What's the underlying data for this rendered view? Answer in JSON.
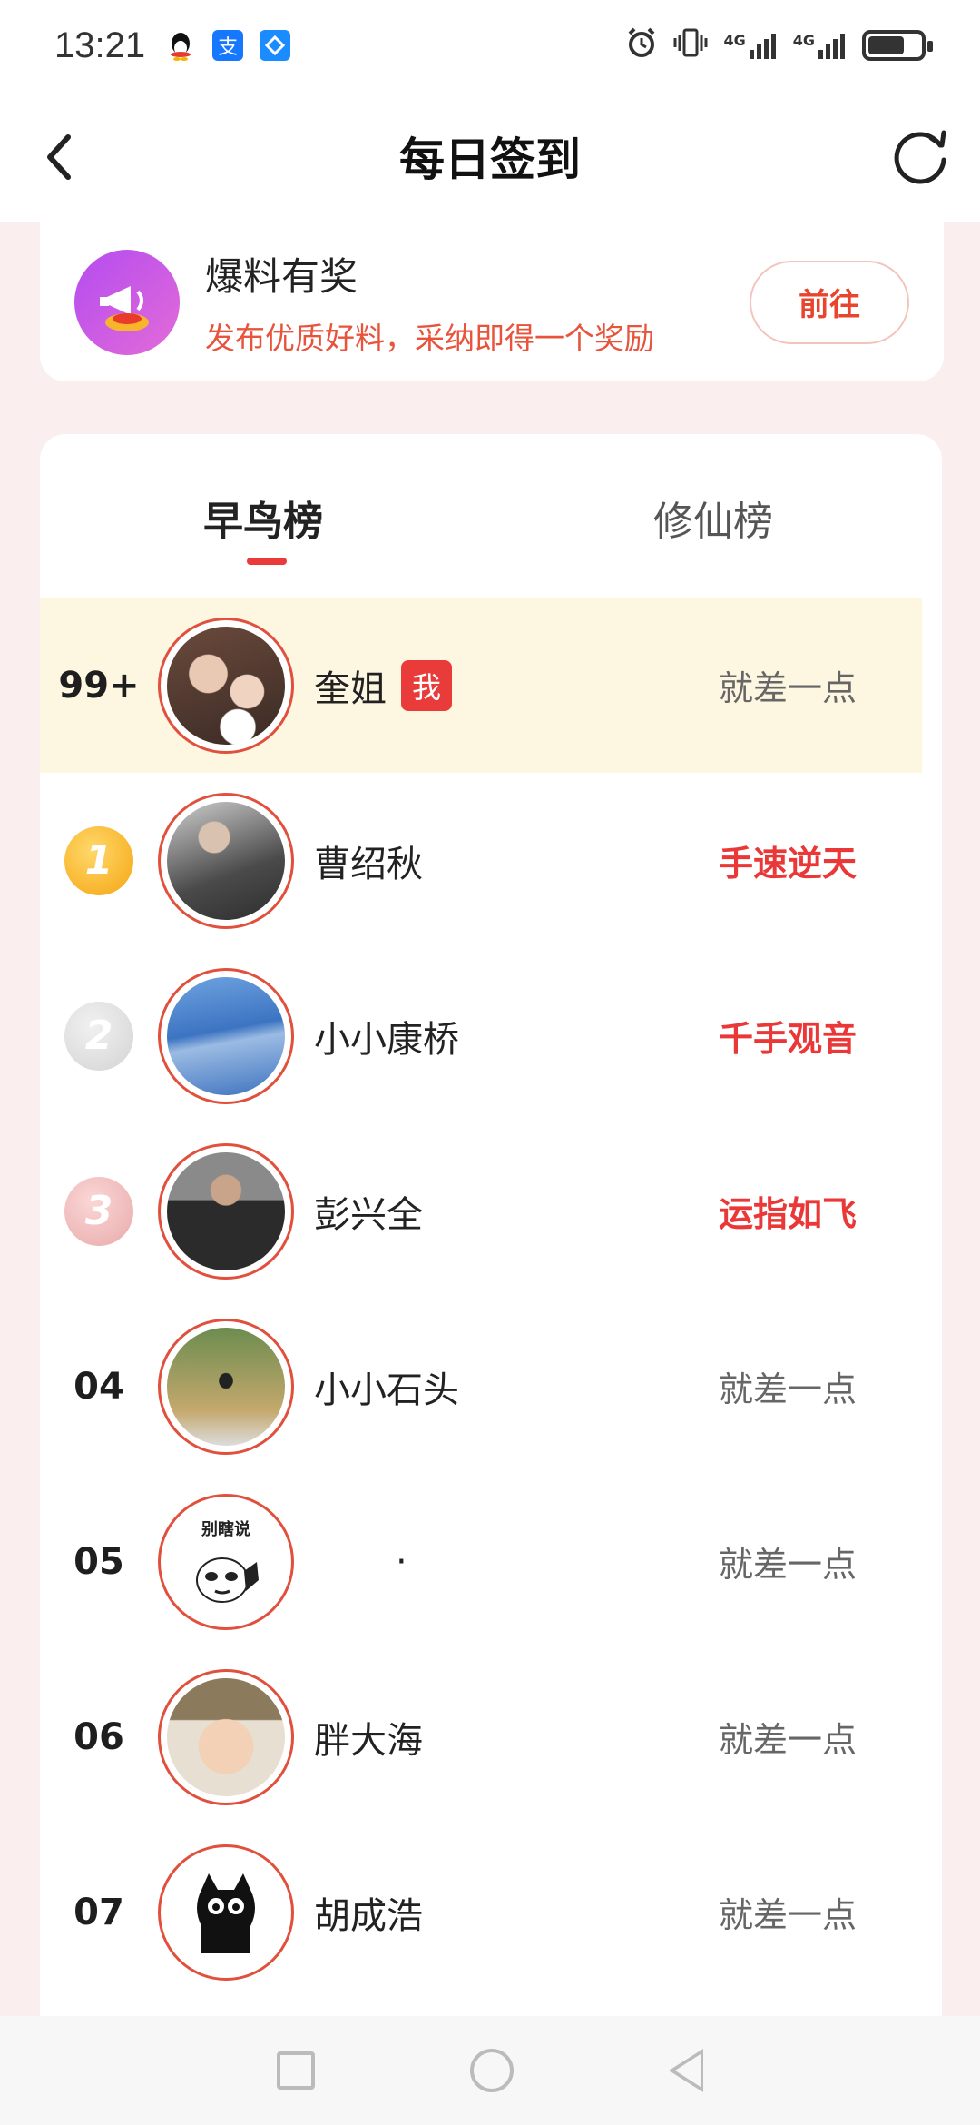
{
  "status_bar": {
    "time": "13:21",
    "notifications": [
      "qq-icon",
      "alipay-icon",
      "tencent-app-icon"
    ],
    "right_icons": [
      "alarm-icon",
      "vibrate-icon",
      "signal-4g-icon",
      "signal-4g-icon",
      "battery-icon"
    ],
    "network_1": "4G",
    "network_2": "4G",
    "battery_level": 0.7
  },
  "nav": {
    "title": "每日签到",
    "back_icon": "chevron-left-icon",
    "refresh_icon": "refresh-icon"
  },
  "promo": {
    "title": "爆料有奖",
    "subtitle": "发布优质好料，采纳即得一个奖励",
    "button": "前往",
    "icon": "megaphone-icon"
  },
  "tabs": {
    "active": "早鸟榜",
    "inactive": "修仙榜"
  },
  "ranking": [
    {
      "rank": "99+",
      "name": "奎姐",
      "me_badge": "我",
      "title": "就差一点",
      "hot": false,
      "me": true,
      "avatar_color": "#7a5a4a"
    },
    {
      "rank": "1",
      "name": "曹绍秋",
      "title": "手速逆天",
      "hot": true,
      "medal": "gold",
      "avatar_color": "#8a8a8a"
    },
    {
      "rank": "2",
      "name": "小小康桥",
      "title": "千手观音",
      "hot": true,
      "medal": "silver",
      "avatar_color": "#4b7fc8"
    },
    {
      "rank": "3",
      "name": "彭兴全",
      "title": "运指如飞",
      "hot": true,
      "medal": "bronze",
      "avatar_color": "#5e5e5e"
    },
    {
      "rank": "04",
      "name": "小小石头",
      "title": "就差一点",
      "hot": false,
      "avatar_color": "#6c8a4c"
    },
    {
      "rank": "05",
      "name": "·",
      "title": "就差一点",
      "hot": false,
      "avatar_color": "#e9e9e9",
      "avatar_caption": "别瞎说"
    },
    {
      "rank": "06",
      "name": "胖大海",
      "title": "就差一点",
      "hot": false,
      "avatar_color": "#c99a6e"
    },
    {
      "rank": "07",
      "name": "胡成浩",
      "title": "就差一点",
      "hot": false,
      "avatar_color": "#1a1a1a"
    }
  ],
  "bottom_nav": [
    "recents-square-icon",
    "home-circle-icon",
    "back-triangle-icon"
  ],
  "colors": {
    "accent": "#ea3a3a",
    "promo_text": "#e8533c",
    "me_row_bg": "#fdf6e1",
    "page_bg": "#fbeeee"
  }
}
